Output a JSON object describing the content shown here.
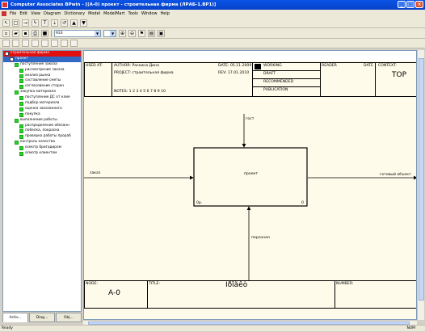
{
  "window": {
    "title": "Computer Associates BPwin - [(A-0) проект - строительная фирма  (ЛРАБ-1.BP1)]"
  },
  "menu": [
    "File",
    "Edit",
    "View",
    "Diagram",
    "Dictionary",
    "Model",
    "ModelMart",
    "Tools",
    "Window",
    "Help"
  ],
  "toolbar": {
    "font_value": "933",
    "zoom_value": ""
  },
  "tree": [
    {
      "label": "строительная фирма",
      "level": 0,
      "style": "hl"
    },
    {
      "label": "проект",
      "level": 1,
      "style": "sel"
    },
    {
      "label": "поступление заказа",
      "level": 2
    },
    {
      "label": "рассмотрение заказа",
      "level": 3
    },
    {
      "label": "анализ рынка",
      "level": 3
    },
    {
      "label": "составление сметы",
      "level": 3
    },
    {
      "label": "согласование сторон",
      "level": 3
    },
    {
      "label": "закупка материала",
      "level": 2
    },
    {
      "label": "поступление ДС от клие",
      "level": 3
    },
    {
      "label": "подбор материала",
      "level": 3
    },
    {
      "label": "оценка заказанного",
      "level": 3
    },
    {
      "label": "покупка",
      "level": 3
    },
    {
      "label": "выполнение работы",
      "level": 2
    },
    {
      "label": "распределение обязанн",
      "level": 3
    },
    {
      "label": "побелка, покраска",
      "level": 3
    },
    {
      "label": "проверка работы прораб",
      "level": 3
    },
    {
      "label": "контроль качества",
      "level": 2
    },
    {
      "label": "осмотр бригадиром",
      "level": 3
    },
    {
      "label": "осмотр клиентом",
      "level": 3
    }
  ],
  "sidetabs": [
    "Activ...",
    "Diag...",
    "Obj..."
  ],
  "header": {
    "used_at": "USED AT:",
    "author": "AUTHOR:  Раскина Дина",
    "project": "PROJECT:  строительная фирма",
    "notes": "NOTES:  1  2  3  4  5  6  7  8  9  10",
    "date": "DATE:  05.11.2009",
    "rev": "REV:     17.01.2010",
    "working": "WORKING",
    "draft": "DRAFT",
    "recommended": "RECOMMENDED",
    "publication": "PUBLICATION",
    "reader": "READER",
    "date2": "DATE",
    "context": "CONTEXT:",
    "top": "TOP"
  },
  "diagram": {
    "box_label": "проект",
    "box_cost": "0р.",
    "box_num": "0",
    "control": "гост",
    "input": "заказ",
    "output": "готовый объект",
    "mechanism": "персонал"
  },
  "footer": {
    "node_label": "NODE:",
    "node_value": "A-0",
    "title_label": "TITLE:",
    "title_value": "Ïðîåêò",
    "number_label": "NUMBER:"
  },
  "status": {
    "left": "Ready",
    "right": "NUM"
  }
}
